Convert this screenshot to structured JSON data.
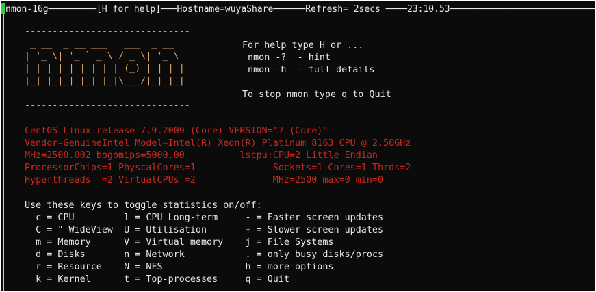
{
  "window": {
    "title_line": "nmon-16g─────────[H for help]───Hostname=wuyaShare──────Refresh= 2secs ────23:10.53──────────────────────────────"
  },
  "logo": {
    "lines": [
      "------------------------------",
      " _ __  _ __ ___   ___  _ __  ",
      "| '_ \\| '_ ` _ \\ / _ \\| '_ \\ ",
      "| | | | | | | | | (_) | | | |",
      "|_| |_|_| |_| |_|\\___/|_| |_|",
      "",
      "------------------------------"
    ]
  },
  "help": {
    "lines": [
      "For help type H or ...",
      " nmon -?  - hint",
      " nmon -h  - full details",
      "",
      "To stop nmon type q to Quit"
    ]
  },
  "system_info": {
    "lines": [
      "CentOS Linux release 7.9.2009 (Core) VERSION=\"7 (Core)\"",
      "Vendor=GenuineIntel Model=Intel(R) Xeon(R) Platinum 8163 CPU @ 2.50GHz",
      "MHz=2500.002 bogomips=5000.00          lscpu:CPU=2 Little Endian",
      "ProcessorChips=1 PhyscalCores=1              Sockets=1 Cores=1 Thrds=2",
      "Hyperthreads  =2 VirtualCPUs =2              MHz=2500 max=0 min=0"
    ]
  },
  "keys": {
    "heading": "Use these keys to toggle statistics on/off:",
    "rows": [
      "  c = CPU         l = CPU Long-term     - = Faster screen updates",
      "  C = \" WideView  U = Utilisation       + = Slower screen updates",
      "  m = Memory      V = Virtual memory    j = File Systems",
      "  d = Disks       n = Network           . = only busy disks/procs",
      "  r = Resource    N = NFS               h = more options",
      "  k = Kernel      t = Top-processes     q = Quit"
    ]
  },
  "colors": {
    "logo": "#e0a86a",
    "system_info": "#c8291e",
    "text": "#e6e6e6",
    "cursor": "#2ecc40",
    "background": "#0b0b0b"
  }
}
